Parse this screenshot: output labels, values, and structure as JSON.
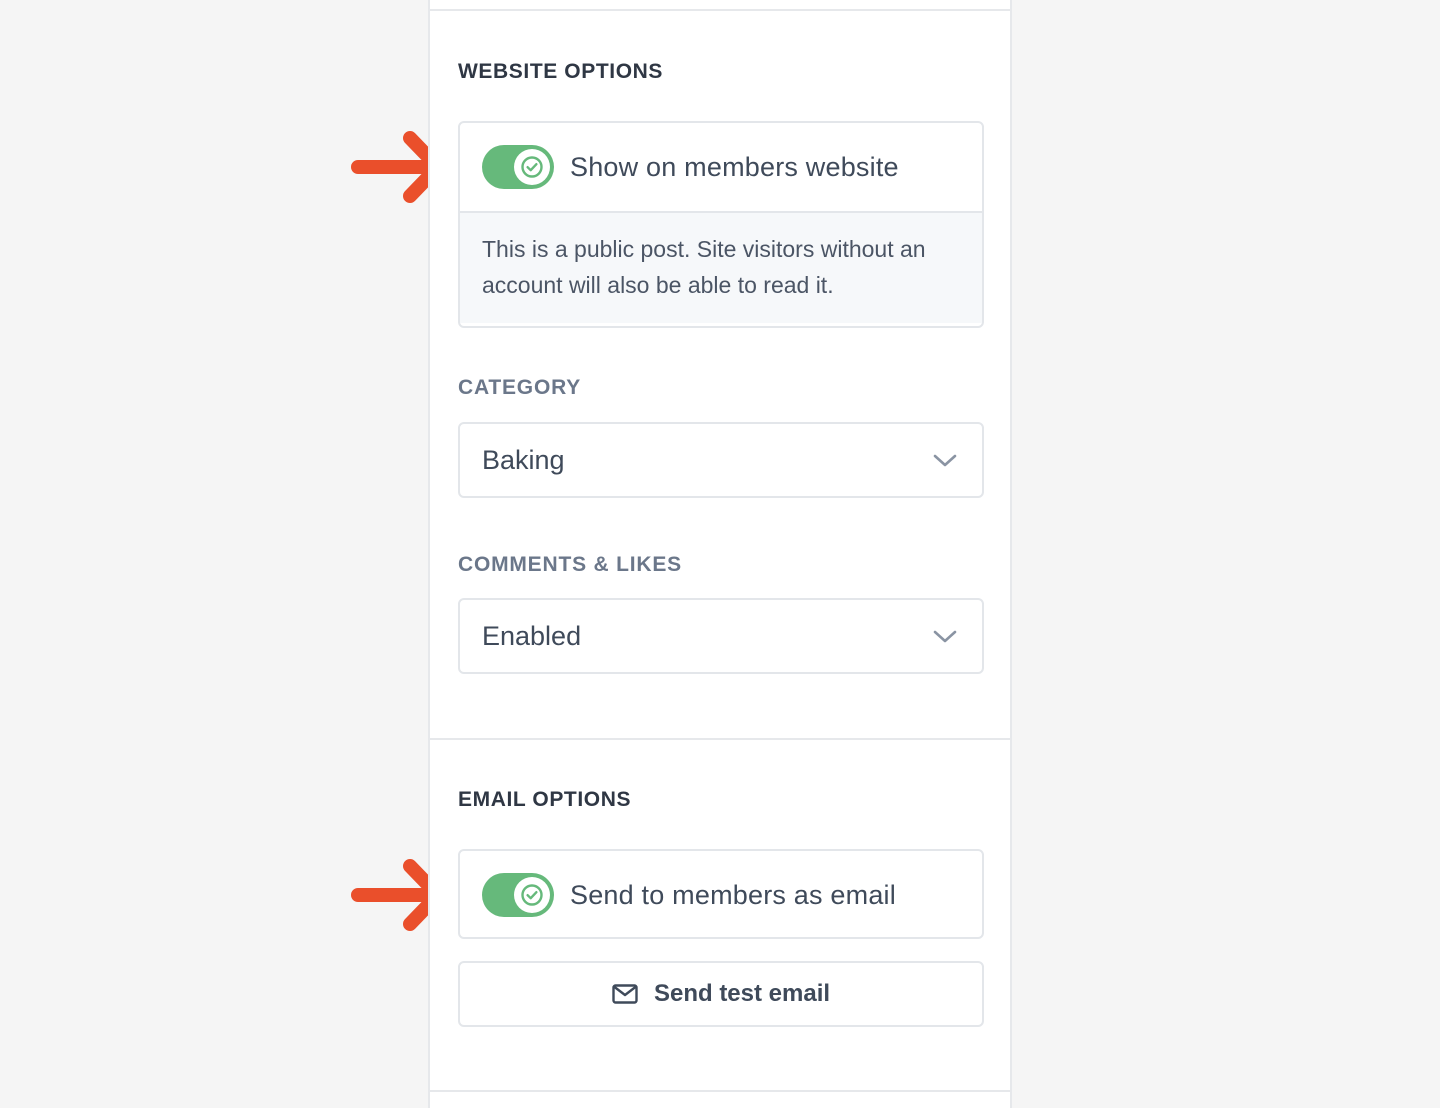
{
  "website_options": {
    "title": "WEBSITE OPTIONS",
    "show_on_website": {
      "label": "Show on members website",
      "enabled": true,
      "note": "This is a public post. Site visitors without an account will also be able to read it."
    },
    "category": {
      "label": "CATEGORY",
      "value": "Baking"
    },
    "comments_likes": {
      "label": "COMMENTS & LIKES",
      "value": "Enabled"
    }
  },
  "email_options": {
    "title": "EMAIL OPTIONS",
    "send_as_email": {
      "label": "Send to members as email",
      "enabled": true
    },
    "send_test_button": {
      "label": "Send test email",
      "icon": "mail-icon"
    }
  },
  "colors": {
    "toggle_on": "#66b97b",
    "arrow": "#ea4f2b",
    "panel_bg": "#ffffff",
    "page_bg": "#f5f5f5"
  }
}
